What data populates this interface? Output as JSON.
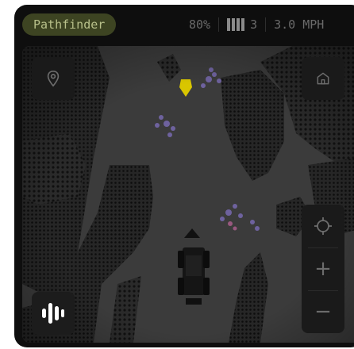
{
  "vehicle": {
    "name": "Pathfinder"
  },
  "status": {
    "battery": "80%",
    "signal_bars_count": "3",
    "speed": "3.0 MPH"
  },
  "map_controls": {
    "location_icon": "location-pin-icon",
    "home_icon": "home-icon",
    "recenter_icon": "crosshair-icon",
    "zoom_in_label": "+",
    "zoom_out_label": "−",
    "voice_icon": "voice-waveform-icon"
  },
  "colors": {
    "frame": "#0e0e0e",
    "pill_bg": "#3d4422",
    "pill_text": "#b8c08a",
    "target_marker": "#d9c600",
    "obstacle_purple": "#7a6ab8",
    "obstacle_magenta": "#a06090"
  }
}
